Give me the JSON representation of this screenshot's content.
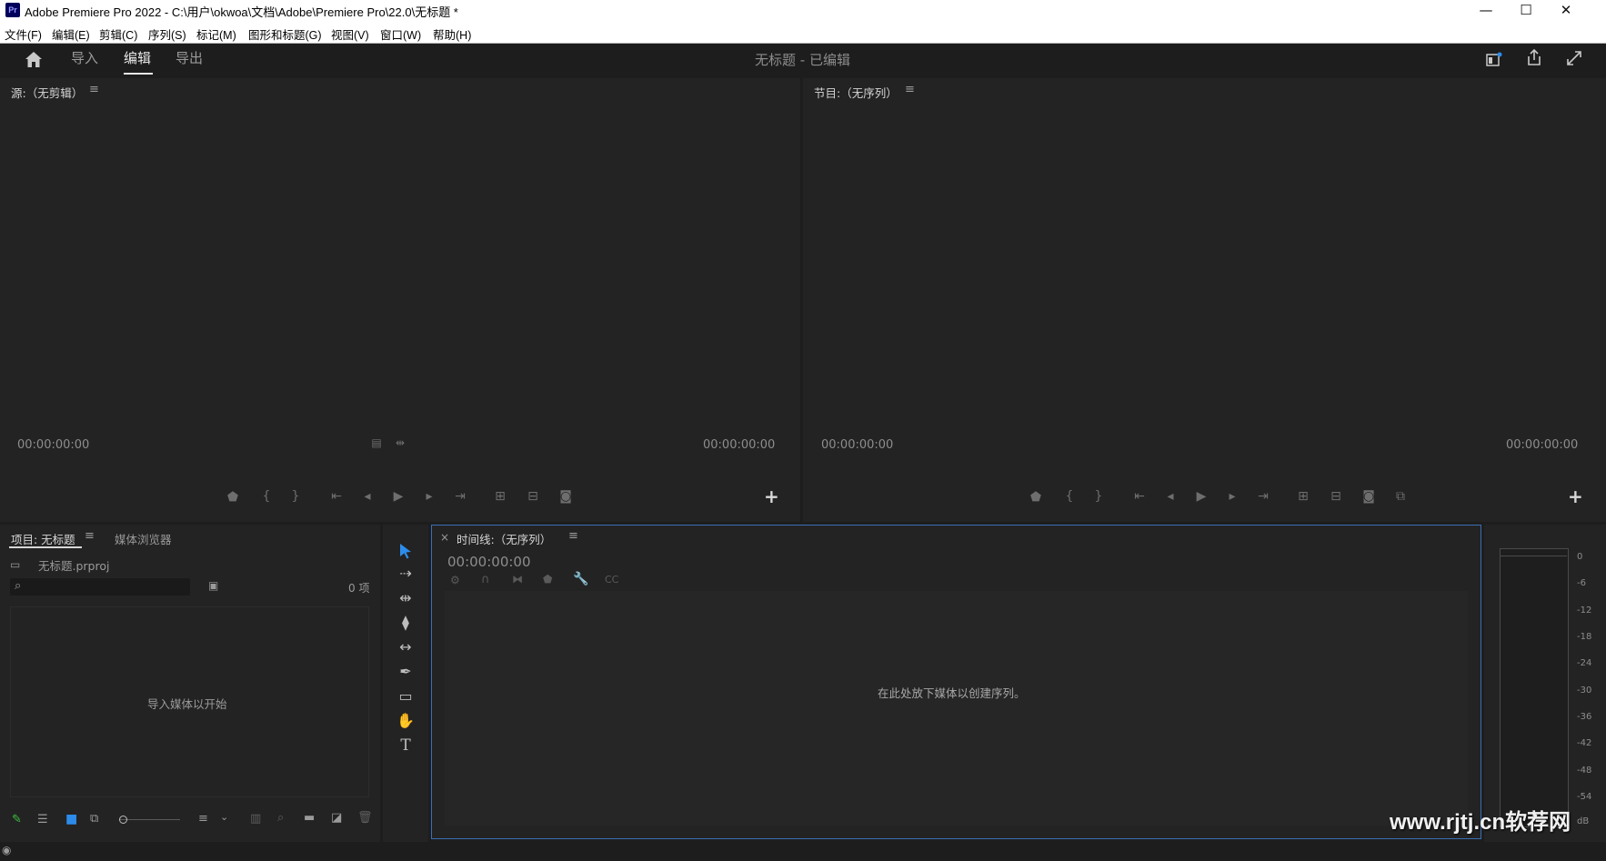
{
  "window": {
    "app_badge": "Pr",
    "title": "Adobe Premiere Pro 2022 - C:\\用户\\okwoa\\文档\\Adobe\\Premiere Pro\\22.0\\无标题 *",
    "minimize": "—",
    "maximize": "☐",
    "close": "✕"
  },
  "menu": [
    "文件(F)",
    "编辑(E)",
    "剪辑(C)",
    "序列(S)",
    "标记(M)",
    "图形和标题(G)",
    "视图(V)",
    "窗口(W)",
    "帮助(H)"
  ],
  "header": {
    "tabs": [
      "导入",
      "编辑",
      "导出"
    ],
    "active_tab": "编辑",
    "doc_title": "无标题 - 已编辑"
  },
  "source_monitor": {
    "title": "源:（无剪辑）",
    "tc_left": "00:00:00:00",
    "tc_right": "00:00:00:00"
  },
  "program_monitor": {
    "title": "节目:（无序列）",
    "tc_left": "00:00:00:00",
    "tc_right": "00:00:00:00"
  },
  "project_panel": {
    "tab_project": "项目: 无标题",
    "tab_media_browser": "媒体浏览器",
    "file_name": "无标题.prproj",
    "item_count": "0 项",
    "empty_message": "导入媒体以开始"
  },
  "timeline": {
    "close": "×",
    "title": "时间线:（无序列）",
    "timecode": "00:00:00:00",
    "empty_message": "在此处放下媒体以创建序列。"
  },
  "audio_meter": {
    "ticks": [
      "0",
      "-6",
      "-12",
      "-18",
      "-24",
      "-30",
      "-36",
      "-42",
      "-48",
      "-54",
      "dB"
    ]
  },
  "watermark": "www.rjtj.cn软荐网",
  "colors": {
    "panel_bg": "#232323",
    "app_bg": "#1d1d1d",
    "accent_blue": "#2d8ceb",
    "focus_border": "#3b6fb5"
  }
}
